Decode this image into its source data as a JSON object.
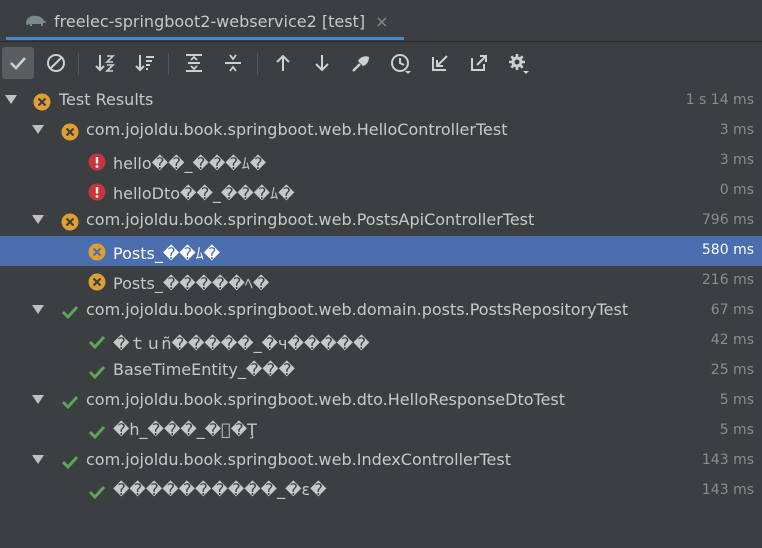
{
  "tab": {
    "title": "freelec-springboot2-webservice2 [test]",
    "close": "×"
  },
  "colors": {
    "failed": "#e0a030",
    "error": "#c7363b",
    "passed": "#5aa755",
    "selection": "#4b6eaf"
  },
  "toolbar": {
    "icons": [
      "show-passed-icon",
      "show-ignored-icon",
      "sort-alpha-icon",
      "sort-duration-icon",
      "expand-all-icon",
      "collapse-all-icon",
      "previous-failed-icon",
      "next-failed-icon",
      "import-tests-icon",
      "test-history-icon",
      "export-icon",
      "open-external-icon",
      "settings-icon"
    ]
  },
  "results": {
    "root": {
      "label": "Test Results",
      "time": "1 s 14 ms",
      "status": "failed"
    },
    "rows": [
      {
        "label": "com.jojoldu.book.springboot.web.HelloControllerTest",
        "time": "3 ms",
        "status": "failed"
      },
      {
        "label": "hello��_���ﾑ�",
        "time": "3 ms",
        "status": "error"
      },
      {
        "label": "helloDto��_���ﾑ�",
        "time": "0 ms",
        "status": "error"
      },
      {
        "label": "com.jojoldu.book.springboot.web.PostsApiControllerTest",
        "time": "796 ms",
        "status": "failed"
      },
      {
        "label": "Posts_��ﾑ�",
        "time": "580 ms",
        "status": "failed"
      },
      {
        "label": "Posts_�����ﾍ�",
        "time": "216 ms",
        "status": "failed"
      },
      {
        "label": "com.jojoldu.book.springboot.web.domain.posts.PostsRepositoryTest",
        "time": "67 ms",
        "status": "passed"
      },
      {
        "label": "�ｔｕñ�����_�ч�����",
        "time": "42 ms",
        "status": "passed"
      },
      {
        "label": "BaseTimeEntity_���",
        "time": "25 ms",
        "status": "passed"
      },
      {
        "label": "com.jojoldu.book.springboot.web.dto.HelloResponseDtoTest",
        "time": "5 ms",
        "status": "passed"
      },
      {
        "label": "�һ_���_�⃞�Ţ",
        "time": "5 ms",
        "status": "passed"
      },
      {
        "label": "com.jojoldu.book.springboot.web.IndexControllerTest",
        "time": "143 ms",
        "status": "passed"
      },
      {
        "label": "����������_�ε�",
        "time": "143 ms",
        "status": "passed"
      }
    ]
  }
}
